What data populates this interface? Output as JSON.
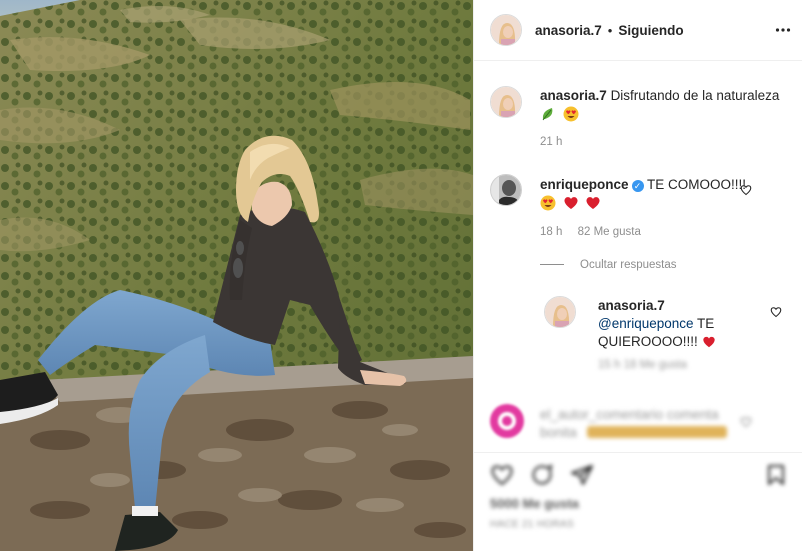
{
  "header": {
    "username": "anasoria.7",
    "separator": "•",
    "follow_status": "Siguiendo"
  },
  "caption": {
    "username": "anasoria.7",
    "text": "Disfrutando de la naturaleza",
    "time": "21 h"
  },
  "comments": [
    {
      "username": "enriqueponce",
      "verified": true,
      "text": "TE COMOOO!!!!",
      "time": "18 h",
      "likes": "82 Me gusta",
      "hide_replies": "Ocultar respuestas"
    }
  ],
  "reply": {
    "username": "anasoria.7",
    "mention": "@enriqueponce",
    "text": "TE QUIEROOOO!!!!",
    "meta_blurred": "15 h   18 Me gusta"
  },
  "blurred_comment": {
    "line1": "el_autor_comentario comenta",
    "line2": "bonita"
  },
  "footer": {
    "likes_blurred": "5000 Me gusta",
    "date_blurred": "HACE 21 HORAS"
  },
  "colors": {
    "accent_blue": "#3897f0",
    "heart_red": "#ed4956",
    "muted_text": "#8e8e8e"
  }
}
